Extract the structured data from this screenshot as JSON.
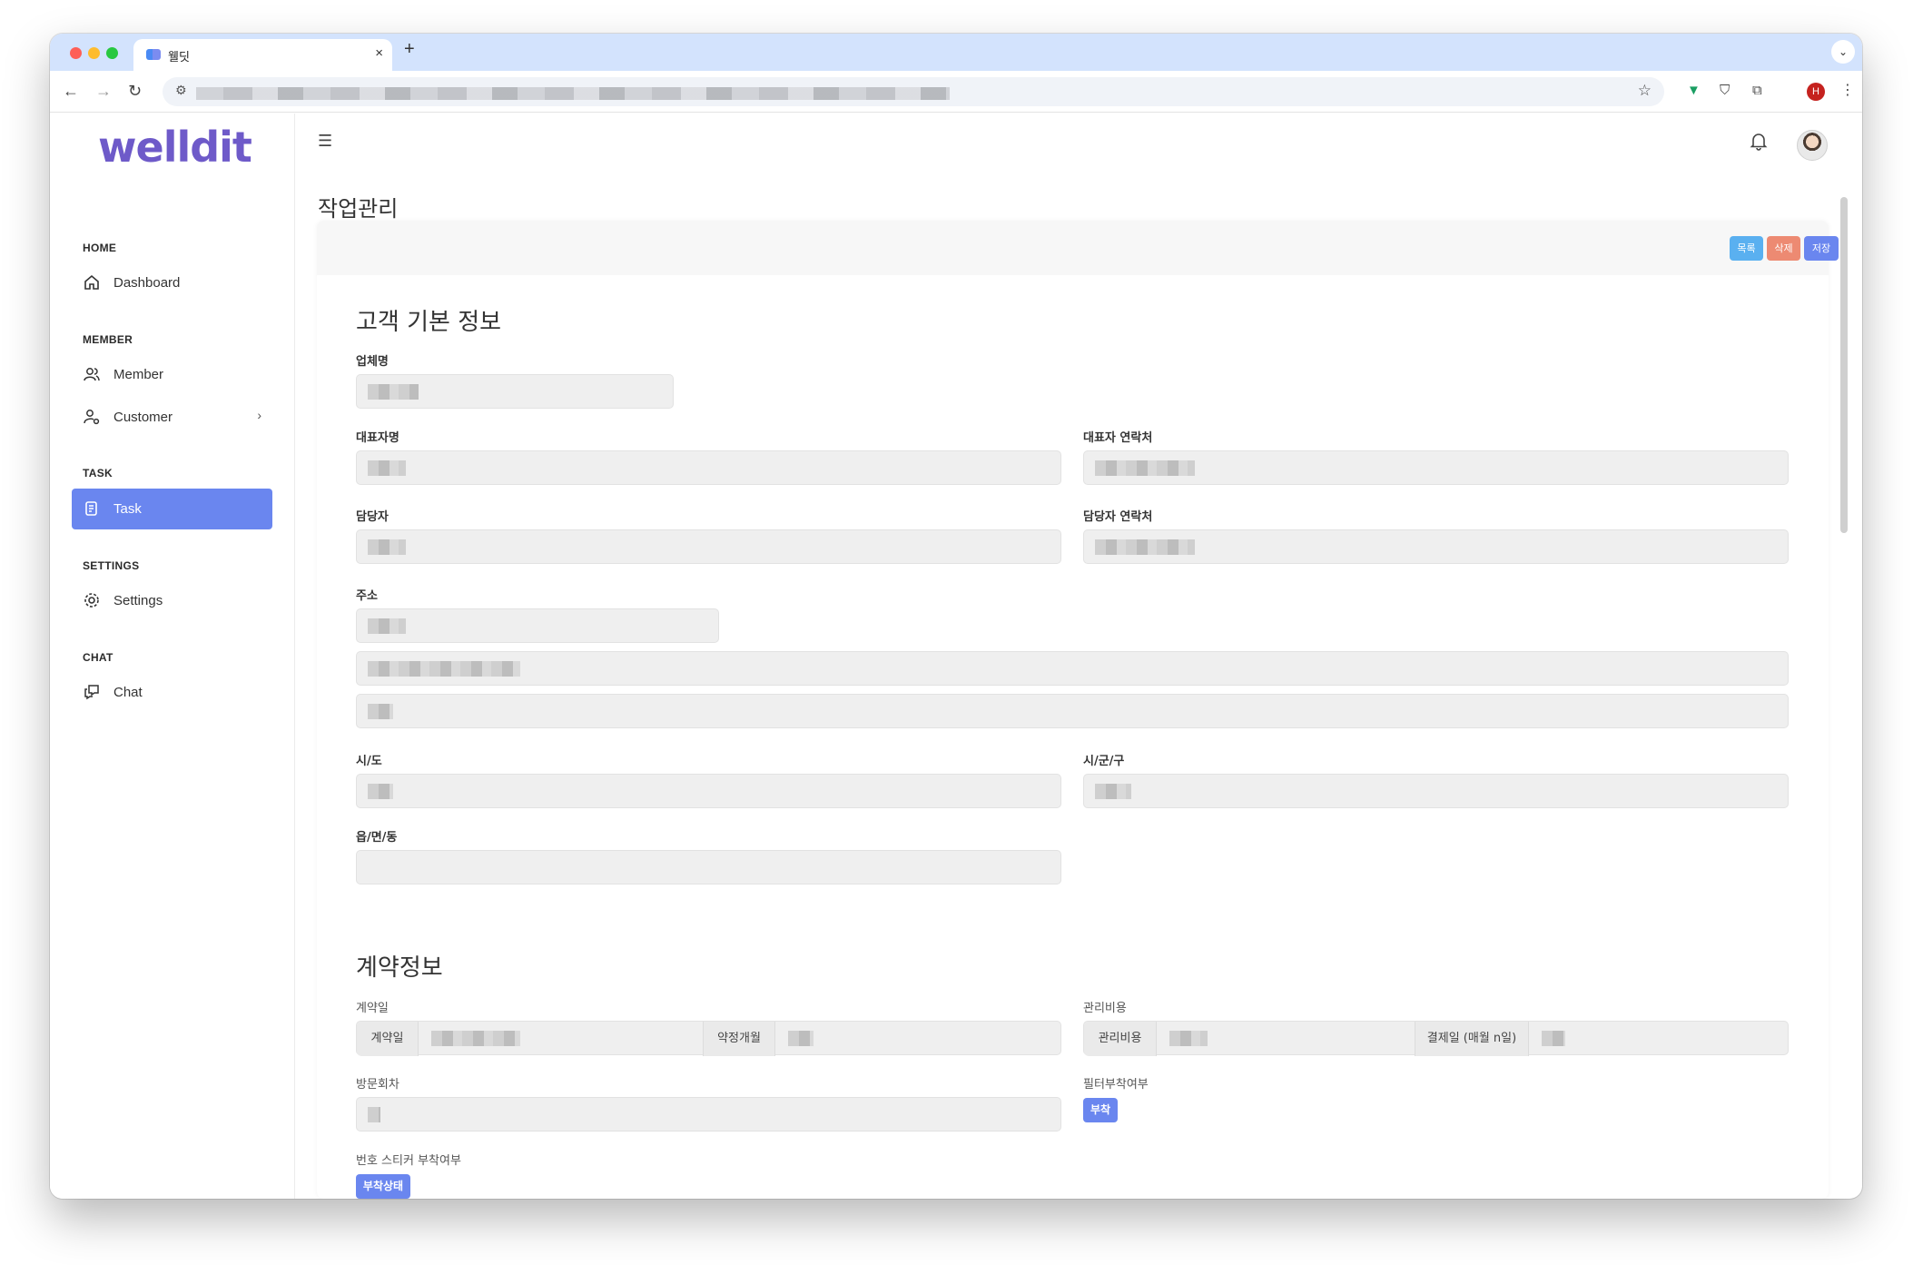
{
  "browser": {
    "tab_title": "웰딧",
    "tab_close": "×",
    "new_tab": "+",
    "profile_initial": "H"
  },
  "sidebar": {
    "logo": "welldit",
    "sections": [
      {
        "title": "HOME",
        "items": [
          {
            "label": "Dashboard",
            "icon": "home-icon"
          }
        ]
      },
      {
        "title": "MEMBER",
        "items": [
          {
            "label": "Member",
            "icon": "users-icon"
          },
          {
            "label": "Customer",
            "icon": "user-gear-icon"
          }
        ]
      },
      {
        "title": "TASK",
        "items": [
          {
            "label": "Task",
            "icon": "task-icon"
          }
        ]
      },
      {
        "title": "SETTINGS",
        "items": [
          {
            "label": "Settings",
            "icon": "gear-icon"
          }
        ]
      },
      {
        "title": "CHAT",
        "items": [
          {
            "label": "Chat",
            "icon": "chat-icon"
          }
        ]
      }
    ],
    "active_item": "Task"
  },
  "main": {
    "page_title": "작업관리",
    "actions": {
      "list": "목록",
      "delete": "삭제",
      "save": "저장"
    },
    "customer_section": {
      "title": "고객 기본 정보",
      "company_name": "업체명",
      "ceo_name": "대표자명",
      "ceo_contact": "대표자 연락처",
      "manager": "담당자",
      "manager_contact": "담당자 연락처",
      "address": "주소",
      "sido": "시/도",
      "sigungu": "시/군/구",
      "eupmyeondong": "읍/면/동"
    },
    "contract_section": {
      "title": "계약정보",
      "contract_date": "계약일",
      "contract_date_prefix": "계약일",
      "contract_months_prefix": "약정개월",
      "mgmt_cost": "관리비용",
      "mgmt_cost_prefix": "관리비용",
      "payment_day_prefix": "결제일 (매월 n일)",
      "visit_count": "방문회차",
      "filter_attached": "필터부착여부",
      "filter_attached_chip": "부착",
      "sticker_attached": "번호 스티커 부착여부",
      "sticker_attached_chip": "부착상태"
    }
  },
  "colors": {
    "accent": "#6a86ef",
    "logo": "#6e5ac9",
    "list_button": "#5ab0f0",
    "delete_button": "#ed8a72"
  }
}
